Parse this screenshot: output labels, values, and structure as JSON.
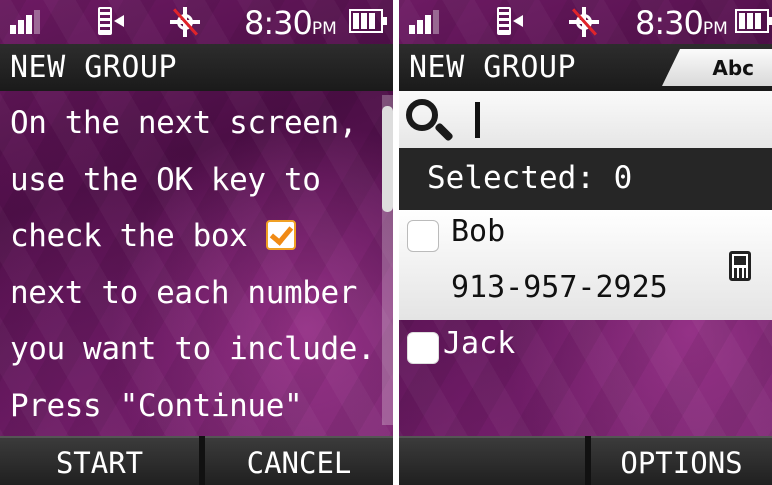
{
  "left_screen": {
    "status": {
      "time": "8:30",
      "ampm": "PM"
    },
    "title": "NEW GROUP",
    "instructions": {
      "line1": "On the next screen,",
      "line2": "use the OK key to",
      "line3": "check the box",
      "line4": "next to each number",
      "line5": "you want to include.",
      "line6": "Press \"Continue\""
    },
    "scroll_position": 0.05,
    "softkeys": {
      "left": "START",
      "right": "CANCEL"
    }
  },
  "right_screen": {
    "status": {
      "time": "8:30",
      "ampm": "PM"
    },
    "title": "NEW GROUP",
    "input_mode": "Abc",
    "search": {
      "value": "",
      "placeholder": ""
    },
    "selected_label": "Selected: 0",
    "contacts": [
      {
        "name": "Bob",
        "number": "913-957-2925",
        "checked": false,
        "type_icon": "mobile-phone-icon"
      },
      {
        "name": "Jack",
        "checked": false
      }
    ],
    "softkeys": {
      "left": "",
      "right": "OPTIONS"
    }
  },
  "colors": {
    "background_purple": "#5e1658",
    "bar_dark": "#262626",
    "checkmark_orange": "#f08a14"
  }
}
